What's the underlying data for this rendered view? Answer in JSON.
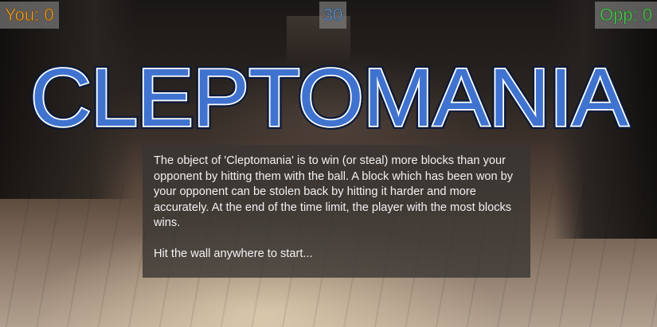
{
  "hud": {
    "player_score": "You: 0",
    "timer": "30",
    "opponent_score": "Opp: 0"
  },
  "title": "CLEPTOMANIA",
  "info": {
    "description": "The object of 'Cleptomania' is to win (or steal) more blocks than your opponent by hitting them with the ball. A block which has been won by your opponent can be stolen back by hitting it harder and more accurately. At the end of the time limit, the player with the most blocks wins.",
    "prompt": "Hit the wall anywhere to start..."
  },
  "colors": {
    "player": "#e8a23a",
    "timer": "#6a9fd4",
    "opponent": "#5cc85c",
    "title_fill": "#3f73cf"
  }
}
